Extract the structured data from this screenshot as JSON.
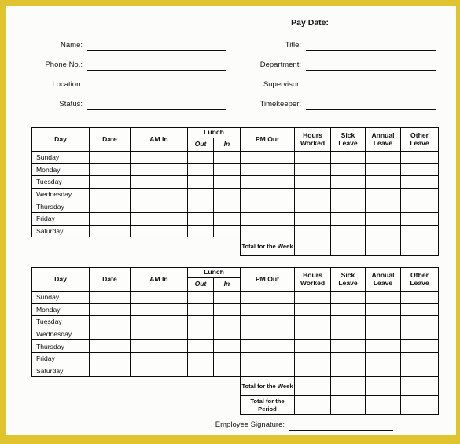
{
  "document": {
    "type": "employee-timesheet-template",
    "frame_color": "#e0c42f",
    "page_color": "#fcfcfb",
    "ink_color": "#101010"
  },
  "header": {
    "pay_date": {
      "label": "Pay Date:",
      "value": ""
    },
    "left_fields": [
      {
        "name": "name",
        "label": "Name:",
        "value": ""
      },
      {
        "name": "phone",
        "label": "Phone No.:",
        "value": ""
      },
      {
        "name": "location",
        "label": "Location:",
        "value": ""
      },
      {
        "name": "status",
        "label": "Status:",
        "value": ""
      }
    ],
    "right_fields": [
      {
        "name": "title",
        "label": "Title:",
        "value": ""
      },
      {
        "name": "department",
        "label": "Department:",
        "value": ""
      },
      {
        "name": "supervisor",
        "label": "Supervisor:",
        "value": ""
      },
      {
        "name": "timekeeper",
        "label": "Timekeeper:",
        "value": ""
      }
    ]
  },
  "table": {
    "columns": {
      "day": "Day",
      "date": "Date",
      "am_in": "AM In",
      "lunch": "Lunch",
      "lunch_out": "Out",
      "lunch_in": "In",
      "pm_out": "PM Out",
      "hours_worked": "Hours Worked",
      "sick_leave": "Sick Leave",
      "annual_leave": "Annual Leave",
      "other_leave": "Other Leave"
    },
    "days": [
      "Sunday",
      "Monday",
      "Tuesday",
      "Wednesday",
      "Thursday",
      "Friday",
      "Saturday"
    ],
    "totals": {
      "week": "Total for the Week",
      "period": "Total for the Period"
    }
  },
  "weeks": [
    {
      "index": 1,
      "rows": [
        {
          "day": "Sunday",
          "date": "",
          "am_in": "",
          "lunch_out": "",
          "lunch_in": "",
          "pm_out": "",
          "hours_worked": "",
          "sick_leave": "",
          "annual_leave": "",
          "other_leave": ""
        },
        {
          "day": "Monday",
          "date": "",
          "am_in": "",
          "lunch_out": "",
          "lunch_in": "",
          "pm_out": "",
          "hours_worked": "",
          "sick_leave": "",
          "annual_leave": "",
          "other_leave": ""
        },
        {
          "day": "Tuesday",
          "date": "",
          "am_in": "",
          "lunch_out": "",
          "lunch_in": "",
          "pm_out": "",
          "hours_worked": "",
          "sick_leave": "",
          "annual_leave": "",
          "other_leave": ""
        },
        {
          "day": "Wednesday",
          "date": "",
          "am_in": "",
          "lunch_out": "",
          "lunch_in": "",
          "pm_out": "",
          "hours_worked": "",
          "sick_leave": "",
          "annual_leave": "",
          "other_leave": ""
        },
        {
          "day": "Thursday",
          "date": "",
          "am_in": "",
          "lunch_out": "",
          "lunch_in": "",
          "pm_out": "",
          "hours_worked": "",
          "sick_leave": "",
          "annual_leave": "",
          "other_leave": ""
        },
        {
          "day": "Friday",
          "date": "",
          "am_in": "",
          "lunch_out": "",
          "lunch_in": "",
          "pm_out": "",
          "hours_worked": "",
          "sick_leave": "",
          "annual_leave": "",
          "other_leave": ""
        },
        {
          "day": "Saturday",
          "date": "",
          "am_in": "",
          "lunch_out": "",
          "lunch_in": "",
          "pm_out": "",
          "hours_worked": "",
          "sick_leave": "",
          "annual_leave": "",
          "other_leave": ""
        }
      ],
      "total_rows": [
        {
          "label": "Total for the Week",
          "hours_worked": "",
          "sick_leave": "",
          "annual_leave": "",
          "other_leave": ""
        }
      ]
    },
    {
      "index": 2,
      "rows": [
        {
          "day": "Sunday",
          "date": "",
          "am_in": "",
          "lunch_out": "",
          "lunch_in": "",
          "pm_out": "",
          "hours_worked": "",
          "sick_leave": "",
          "annual_leave": "",
          "other_leave": ""
        },
        {
          "day": "Monday",
          "date": "",
          "am_in": "",
          "lunch_out": "",
          "lunch_in": "",
          "pm_out": "",
          "hours_worked": "",
          "sick_leave": "",
          "annual_leave": "",
          "other_leave": ""
        },
        {
          "day": "Tuesday",
          "date": "",
          "am_in": "",
          "lunch_out": "",
          "lunch_in": "",
          "pm_out": "",
          "hours_worked": "",
          "sick_leave": "",
          "annual_leave": "",
          "other_leave": ""
        },
        {
          "day": "Wednesday",
          "date": "",
          "am_in": "",
          "lunch_out": "",
          "lunch_in": "",
          "pm_out": "",
          "hours_worked": "",
          "sick_leave": "",
          "annual_leave": "",
          "other_leave": ""
        },
        {
          "day": "Thursday",
          "date": "",
          "am_in": "",
          "lunch_out": "",
          "lunch_in": "",
          "pm_out": "",
          "hours_worked": "",
          "sick_leave": "",
          "annual_leave": "",
          "other_leave": ""
        },
        {
          "day": "Friday",
          "date": "",
          "am_in": "",
          "lunch_out": "",
          "lunch_in": "",
          "pm_out": "",
          "hours_worked": "",
          "sick_leave": "",
          "annual_leave": "",
          "other_leave": ""
        },
        {
          "day": "Saturday",
          "date": "",
          "am_in": "",
          "lunch_out": "",
          "lunch_in": "",
          "pm_out": "",
          "hours_worked": "",
          "sick_leave": "",
          "annual_leave": "",
          "other_leave": ""
        }
      ],
      "total_rows": [
        {
          "label": "Total for the Week",
          "hours_worked": "",
          "sick_leave": "",
          "annual_leave": "",
          "other_leave": ""
        },
        {
          "label": "Total for the Period",
          "hours_worked": "",
          "sick_leave": "",
          "annual_leave": "",
          "other_leave": ""
        }
      ]
    }
  ],
  "footer": {
    "signature": {
      "label": "Employee Signature:",
      "value": ""
    },
    "watermark": ""
  }
}
